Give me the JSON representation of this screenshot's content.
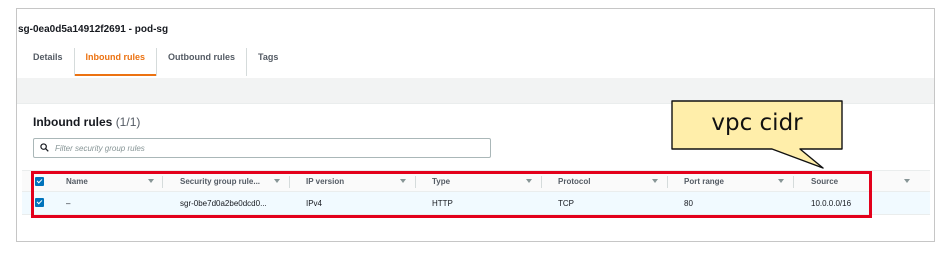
{
  "header": {
    "title": "sg-0ea0d5a14912f2691 - pod-sg"
  },
  "tabs": [
    {
      "label": "Details",
      "active": false
    },
    {
      "label": "Inbound rules",
      "active": true
    },
    {
      "label": "Outbound rules",
      "active": false
    },
    {
      "label": "Tags",
      "active": false
    }
  ],
  "inbound": {
    "title": "Inbound rules",
    "count": "(1/1)",
    "search_placeholder": "Filter security group rules",
    "columns": [
      "Name",
      "Security group rule...",
      "IP version",
      "Type",
      "Protocol",
      "Port range",
      "Source"
    ],
    "rows": [
      {
        "selected": true,
        "cells": [
          "–",
          "sgr-0be7d0a2be0dcd0...",
          "IPv4",
          "HTTP",
          "TCP",
          "80",
          "10.0.0.0/16"
        ]
      }
    ]
  },
  "annotation": {
    "text": "vpc cidr"
  },
  "colors": {
    "accent": "#ec7211",
    "highlight_border": "#e3001b",
    "callout_fill": "#ffeeaa",
    "checkbox": "#0073bb"
  }
}
